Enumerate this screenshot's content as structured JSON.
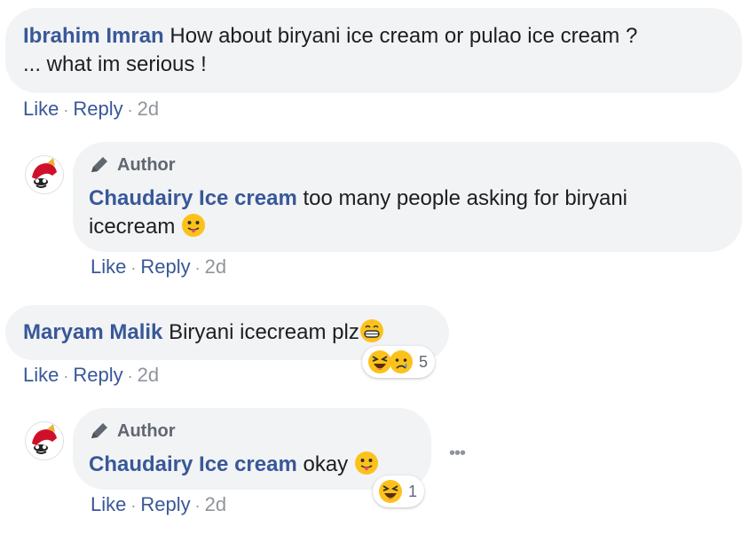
{
  "comments": [
    {
      "author": "Ibrahim Imran",
      "text_line1": "How about biryani ice cream or pulao ice cream ?",
      "text_line2": "... what im serious !",
      "actions": {
        "like": "Like",
        "reply": "Reply",
        "time": "2d"
      }
    },
    {
      "badge": "Author",
      "author": "Chaudairy Ice cream",
      "text_line1": "too many people asking for biryani",
      "text_line2": "icecream",
      "emoji": "tongue-face-emoji",
      "actions": {
        "like": "Like",
        "reply": "Reply",
        "time": "2d"
      }
    },
    {
      "author": "Maryam Malik",
      "text": "Biryani icecream plz",
      "emoji": "grin-emoji",
      "reactions": {
        "icons": [
          "laugh-reaction-icon",
          "sad-reaction-icon"
        ],
        "count": "5"
      },
      "actions": {
        "like": "Like",
        "reply": "Reply",
        "time": "2d"
      }
    },
    {
      "badge": "Author",
      "author": "Chaudairy Ice cream",
      "text": "okay",
      "emoji": "tongue-face-emoji",
      "reactions": {
        "icons": [
          "laugh-reaction-icon"
        ],
        "count": "1"
      },
      "actions": {
        "like": "Like",
        "reply": "Reply",
        "time": "2d"
      }
    }
  ],
  "more_options": "•••",
  "colors": {
    "name": "#385898",
    "bubble": "#f2f3f5",
    "meta": "#90949c",
    "emoji": "#fcc21b"
  }
}
